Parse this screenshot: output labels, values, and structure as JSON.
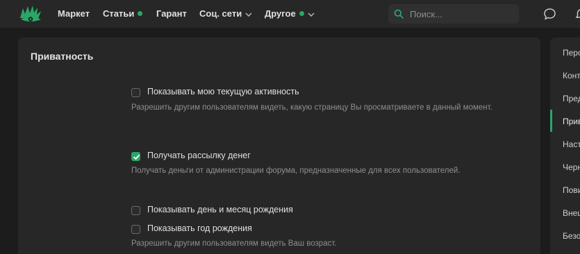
{
  "nav": {
    "items": [
      {
        "label": "Маркет"
      },
      {
        "label": "Статьи"
      },
      {
        "label": "Гарант"
      },
      {
        "label": "Соц. сети"
      },
      {
        "label": "Другое"
      }
    ],
    "search_placeholder": "Поиск..."
  },
  "privacy": {
    "title": "Приватность",
    "options": [
      {
        "label": "Показывать мою текущую активность",
        "checked": false,
        "description": "Разрешить другим пользователям видеть, какую страницу Вы просматриваете в данный момент."
      },
      {
        "label": "Получать рассылку денег",
        "checked": true,
        "description": "Получать деньги от администрации форума, предназначенные для всех пользователей."
      },
      {
        "label": "Показывать день и месяц рождения",
        "checked": false
      },
      {
        "label": "Показывать год рождения",
        "checked": false,
        "description": "Разрешить другим пользователям видеть Ваш возраст."
      }
    ]
  },
  "sidebar": {
    "items": [
      {
        "label": "Перс"
      },
      {
        "label": "Конт"
      },
      {
        "label": "Пред"
      },
      {
        "label": "Прив",
        "active": true
      },
      {
        "label": "Наст"
      },
      {
        "label": "Черн"
      },
      {
        "label": "Пови"
      },
      {
        "label": "Внеш"
      },
      {
        "label": "Безо"
      }
    ]
  },
  "colors": {
    "accent": "#2ba667",
    "background": "#1c1c1c",
    "panel": "#272727"
  }
}
